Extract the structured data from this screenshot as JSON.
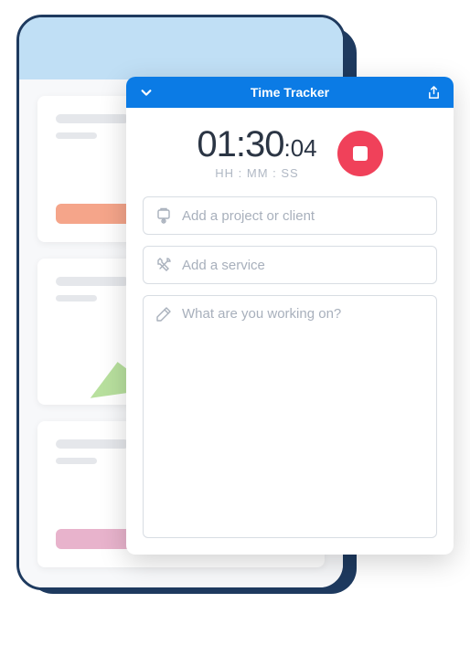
{
  "tracker": {
    "title": "Time Tracker",
    "timer": {
      "hours_minutes": "01:30",
      "seconds": ":04",
      "label": "HH : MM : SS"
    },
    "inputs": {
      "project_placeholder": "Add a project or client",
      "service_placeholder": "Add a service",
      "notes_placeholder": "What are you working on?"
    }
  },
  "colors": {
    "primary": "#0B7BE5",
    "danger": "#F0415A",
    "phone_header": "#C0DFF5",
    "phone_border": "#1E3A5F"
  }
}
